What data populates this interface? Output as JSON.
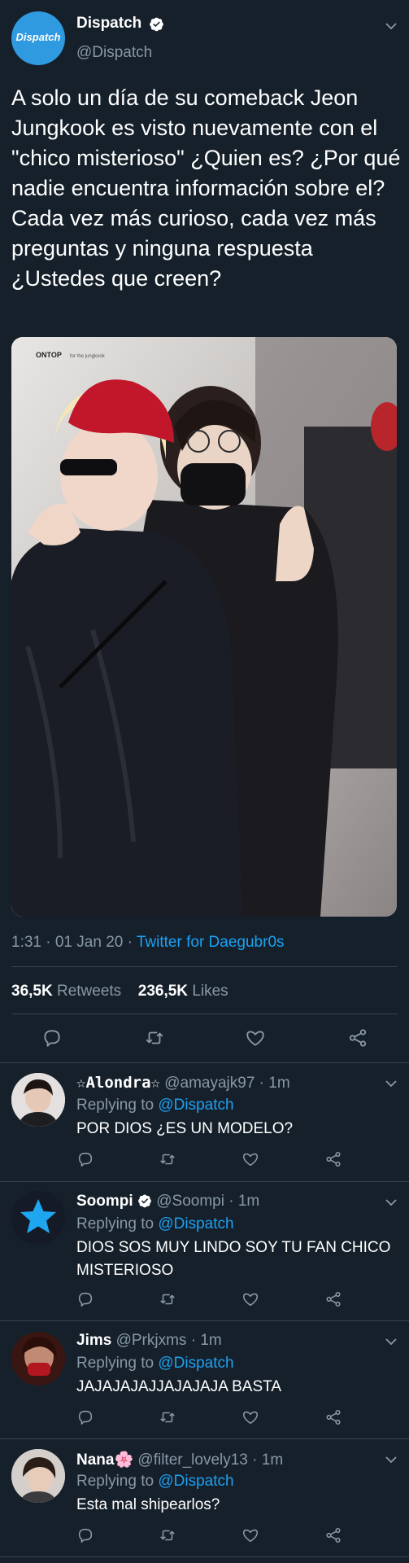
{
  "main_tweet": {
    "avatar_text": "Dispatch",
    "display_name": "Dispatch",
    "handle": "@Dispatch",
    "text": "A solo un día de su comeback Jeon Jungkook es visto nuevamente con el \"chico misterioso\" ¿Quien es? ¿Por qué nadie encuentra información sobre el?\nCada vez más curioso, cada vez más preguntas y ninguna respuesta ¿Ustedes que creen?",
    "photo_watermark": "ONTOP",
    "photo_watermark_sub": "for the jungkook",
    "time": "1:31 · 01 Jan 20 · ",
    "source": "Twitter for Daegubr0s",
    "retweets_count": "36,5K",
    "retweets_label": "Retweets",
    "likes_count": "236,5K",
    "likes_label": "Likes"
  },
  "replies": [
    {
      "display_name": "☆Alondra☆",
      "handle_time": "@amayajk97 · 1m",
      "replying_prefix": "Replying to ",
      "replying_to": "@Dispatch",
      "text": "POR DIOS ¿ES UN MODELO?"
    },
    {
      "display_name": "Soompi",
      "handle_time": "@Soompi · 1m",
      "replying_prefix": "Replying to ",
      "replying_to": "@Dispatch",
      "text": "DIOS SOS MUY LINDO SOY TU FAN CHICO MISTERIOSO"
    },
    {
      "display_name": "Jims",
      "handle_time": "@Prkjxms · 1m",
      "replying_prefix": "Replying to ",
      "replying_to": "@Dispatch",
      "text": "JAJAJAJAJJAJAJAJA BASTA"
    },
    {
      "display_name": "Nana🌸",
      "handle_time": "@filter_lovely13 · 1m",
      "replying_prefix": "Replying to ",
      "replying_to": "@Dispatch",
      "text": "Esta mal shipearlos?"
    }
  ],
  "colors": {
    "background": "#15202b",
    "accent": "#1da1f2",
    "muted": "#8899a6",
    "divider": "#38444d"
  },
  "icons": [
    "verified-icon",
    "chevron-down-icon",
    "reply-icon",
    "retweet-icon",
    "like-icon",
    "share-icon",
    "star-icon"
  ]
}
